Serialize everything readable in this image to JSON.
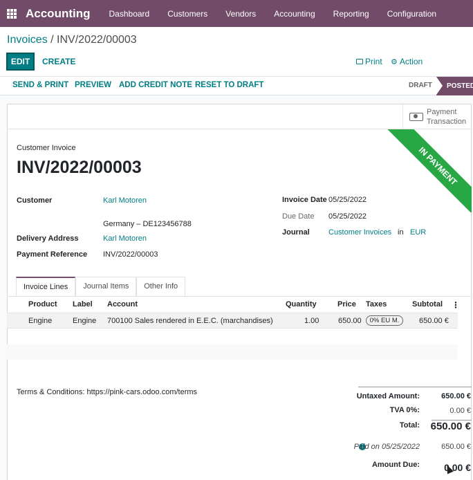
{
  "navbar": {
    "app_name": "Accounting",
    "menu": [
      "Dashboard",
      "Customers",
      "Vendors",
      "Accounting",
      "Reporting",
      "Configuration"
    ]
  },
  "breadcrumb": {
    "parent": "Invoices",
    "separator": " / ",
    "current": "INV/2022/00003"
  },
  "control_panel": {
    "edit": "EDIT",
    "create": "CREATE",
    "print": "Print",
    "action": "Action"
  },
  "statusbar": {
    "buttons": [
      "SEND & PRINT",
      "PREVIEW",
      "ADD CREDIT NOTE",
      "RESET TO DRAFT"
    ],
    "stages": [
      "DRAFT",
      "POSTED"
    ],
    "active_stage": "POSTED"
  },
  "smart_button": {
    "line1": "Payment",
    "line2": "Transaction",
    "icon": "money-icon"
  },
  "ribbon": "IN PAYMENT",
  "document": {
    "type": "Customer Invoice",
    "name": "INV/2022/00003"
  },
  "fields": {
    "customer_label": "Customer",
    "customer": "Karl Motoren",
    "customer_address": "Germany – DE123456788",
    "delivery_label": "Delivery Address",
    "delivery": "Karl Motoren",
    "payment_ref_label": "Payment Reference",
    "payment_ref": "INV/2022/00003",
    "invoice_date_label": "Invoice Date",
    "invoice_date": "05/25/2022",
    "due_date_label": "Due Date",
    "due_date": "05/25/2022",
    "journal_label": "Journal",
    "journal": "Customer Invoices",
    "journal_in": "in",
    "currency": "EUR"
  },
  "tabs": [
    "Invoice Lines",
    "Journal Items",
    "Other Info"
  ],
  "lines": {
    "headers": [
      "Product",
      "Label",
      "Account",
      "Quantity",
      "Price",
      "Taxes",
      "Subtotal"
    ],
    "rows": [
      {
        "product": "Engine",
        "label": "Engine",
        "account": "700100 Sales rendered in E.E.C. (marchandises)",
        "quantity": "1.00",
        "price": "650.00",
        "taxes": "0% EU M.",
        "subtotal": "650.00 €"
      }
    ]
  },
  "terms": "Terms & Conditions: https://pink-cars.odoo.com/terms",
  "totals": {
    "untaxed_label": "Untaxed Amount:",
    "untaxed": "650.00 €",
    "tva_label": "TVA 0%:",
    "tva": "0.00 €",
    "total_label": "Total:",
    "total": "650.00 €",
    "paid_on": "Paid on 05/25/2022",
    "paid_amount": "650.00 €",
    "amount_due_label": "Amount Due:",
    "amount_due": "0.00 €"
  },
  "colors": {
    "brand": "#714b67",
    "link": "#017e84",
    "ribbon": "#28a745"
  }
}
